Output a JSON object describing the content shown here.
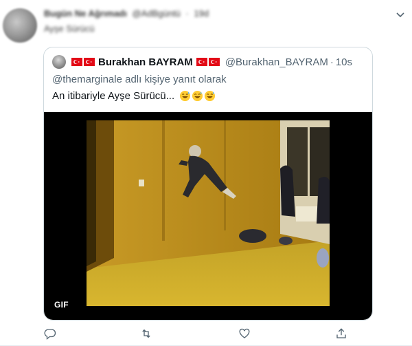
{
  "retweeter": {
    "name": "Bugün Ne Ağrımadı",
    "handle": "@AdBgüntü",
    "time": "19d",
    "text": "Ayşe Sürücü"
  },
  "quoted": {
    "display_name": "Burakhan BAYRAM",
    "handle": "@Burakhan_BAYRAM",
    "separator": "·",
    "time": "10s",
    "reply_context": "@themarginale adlı kişiye yanıt olarak",
    "text": "An itibariyle Ayşe Sürücü...",
    "media_badge": "GIF",
    "flag_icon": "turkey-flag-icon",
    "emoji_icon": "sweat-smile-emoji-icon"
  },
  "actions": [
    "reply-icon",
    "retweet-icon",
    "like-icon",
    "share-icon"
  ],
  "colors": {
    "text_primary": "#0f1419",
    "text_secondary": "#536471",
    "border": "#cfd9de",
    "flag_red": "#e30a17"
  }
}
